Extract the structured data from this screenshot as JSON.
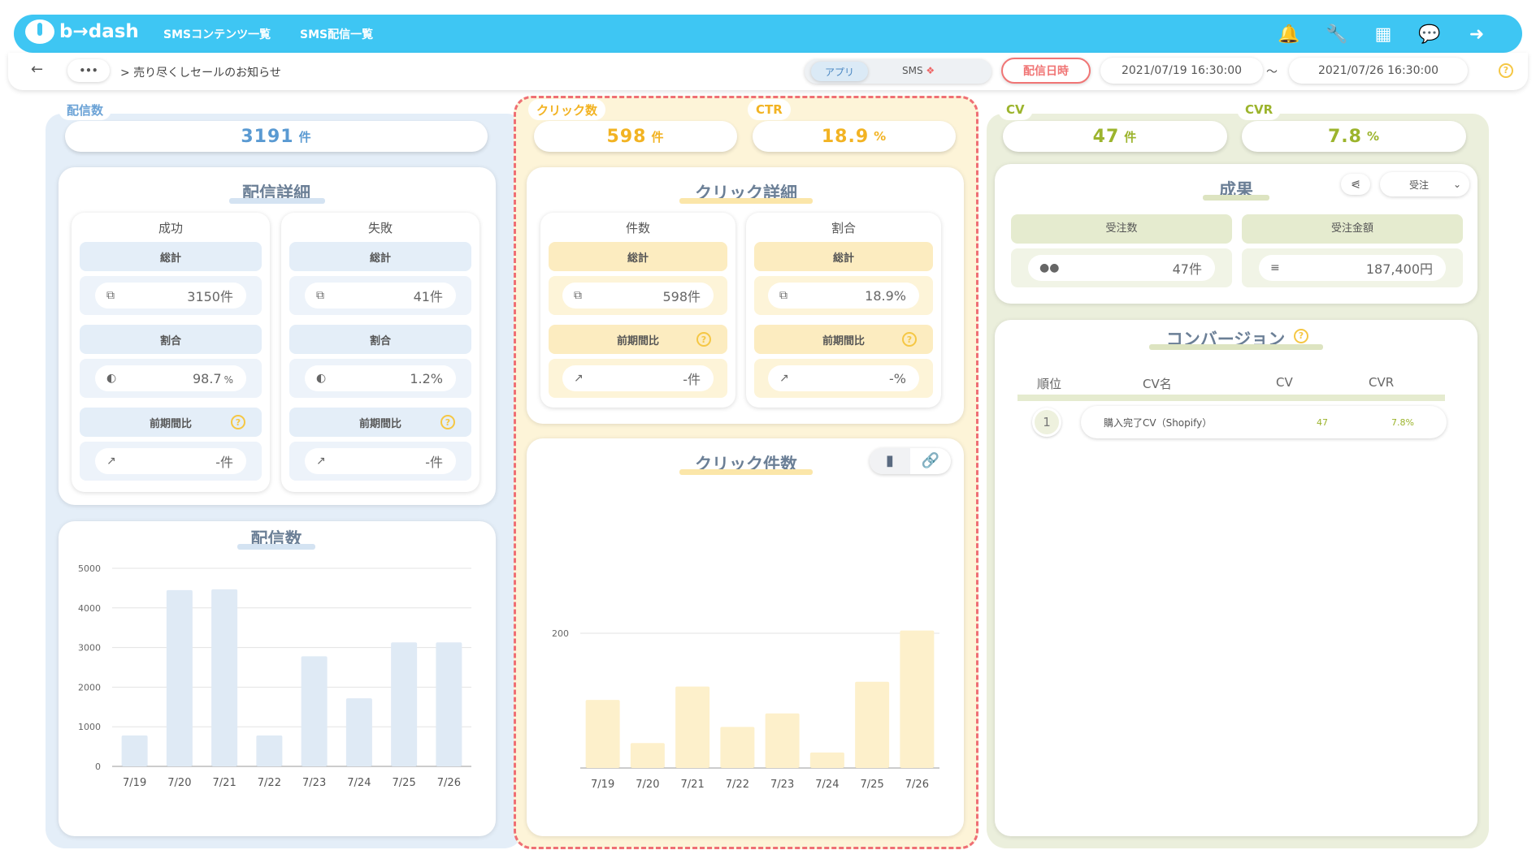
{
  "header": {
    "logo": "b→dash",
    "nav": [
      "SMSコンテンツ一覧",
      "SMS配信一覧"
    ],
    "icons": [
      "bell-icon",
      "wrench-icon",
      "grid-icon",
      "chat-icon",
      "logout-icon"
    ]
  },
  "subbar": {
    "back_icon": "←",
    "more": "•••",
    "breadcrumb": "> 売り尽くしセールのお知らせ",
    "toggle_app": "アプリ",
    "toggle_sms": "SMS",
    "date_label": "配信日時",
    "date_from": "2021/07/19 16:30:00",
    "tilde": "〜",
    "date_to": "2021/07/26 16:30:00",
    "help": "?"
  },
  "delivery": {
    "tag": "配信数",
    "total": "3191",
    "unit": "件",
    "detail_title": "配信詳細",
    "success": {
      "title": "成功",
      "total_label": "総計",
      "total": "3150件",
      "ratio_label": "割合",
      "ratio": "98.7",
      "pct": "%",
      "compare_label": "前期間比",
      "compare": "-件"
    },
    "failure": {
      "title": "失敗",
      "total_label": "総計",
      "total": "41件",
      "ratio_label": "割合",
      "ratio": "1.2%",
      "compare_label": "前期間比",
      "compare": "-件"
    }
  },
  "click": {
    "tag_count": "クリック数",
    "count": "598",
    "unit": "件",
    "tag_ctr": "CTR",
    "ctr": "18.9",
    "pct": "%",
    "detail_title": "クリック詳細",
    "count_col": {
      "title": "件数",
      "total_label": "総計",
      "total": "598件",
      "compare_label": "前期間比",
      "compare": "-件"
    },
    "ratio_col": {
      "title": "割合",
      "total_label": "総計",
      "total": "18.9%",
      "compare_label": "前期間比",
      "compare": "-%"
    }
  },
  "cv": {
    "tag_cv": "CV",
    "cv": "47",
    "unit": "件",
    "tag_cvr": "CVR",
    "cvr": "7.8",
    "pct": "%",
    "result_title": "成果",
    "result_select": "受注",
    "orders_label": "受注数",
    "orders": "47件",
    "amount_label": "受注金額",
    "amount": "187,400円",
    "conversion_title": "コンバージョン",
    "table_headers": [
      "順位",
      "CV名",
      "CV",
      "CVR"
    ],
    "rows": [
      {
        "rank": "1",
        "name": "購入完了CV（Shopify）",
        "cv": "47",
        "cvr": "7.8%"
      }
    ]
  },
  "charts": {
    "delivery_title": "配信数",
    "click_title": "クリック件数"
  },
  "chart_data": [
    {
      "type": "bar",
      "title": "配信数",
      "categories": [
        "7/19",
        "7/20",
        "7/21",
        "7/22",
        "7/23",
        "7/24",
        "7/25",
        "7/26"
      ],
      "values": [
        780,
        4450,
        4470,
        780,
        2780,
        1720,
        3130,
        3130
      ],
      "yticks": [
        0,
        1000,
        2000,
        3000,
        4000,
        5000
      ],
      "ylim": [
        0,
        5000
      ],
      "color": "#dfeaf5"
    },
    {
      "type": "bar",
      "title": "クリック件数",
      "categories": [
        "7/19",
        "7/20",
        "7/21",
        "7/22",
        "7/23",
        "7/24",
        "7/25",
        "7/26"
      ],
      "values": [
        101,
        37,
        121,
        61,
        81,
        23,
        128,
        204
      ],
      "yticks": [
        200
      ],
      "ylim": [
        0,
        200
      ],
      "color": "#fdf0cb"
    }
  ]
}
